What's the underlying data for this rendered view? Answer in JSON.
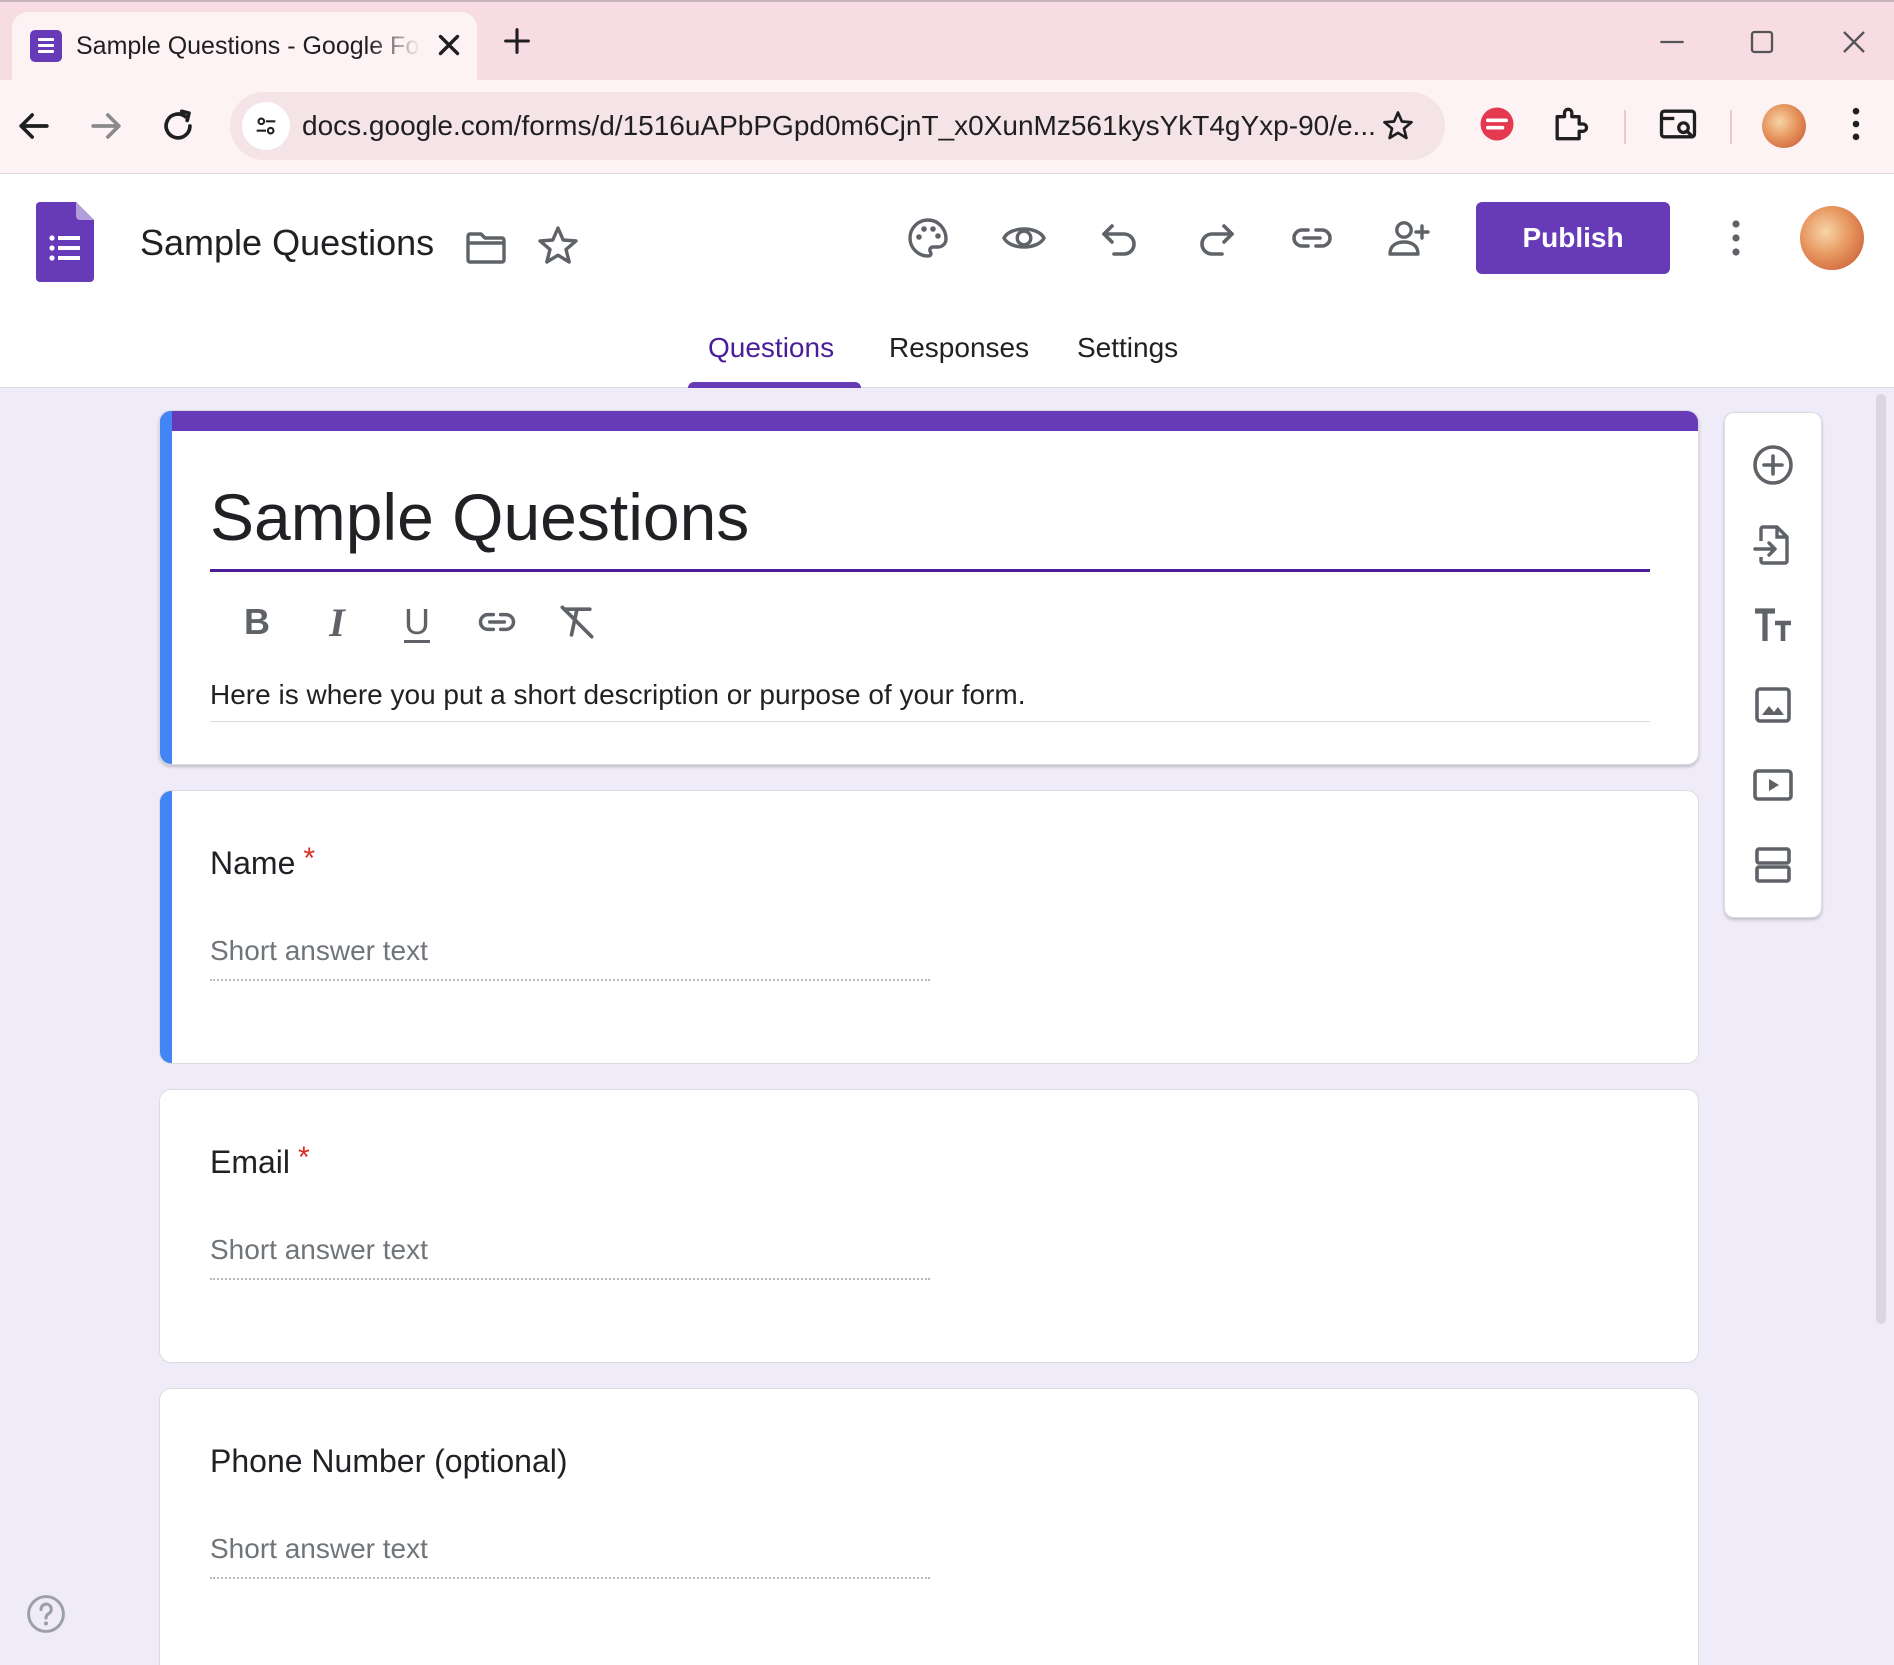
{
  "browser": {
    "tab_title": "Sample Questions - Google Forms",
    "url": "docs.google.com/forms/d/1516uAPbPGpd0m6CjnT_x0XunMz561kysYkT4gYxp-90/e..."
  },
  "header": {
    "doc_title": "Sample Questions",
    "publish_label": "Publish",
    "tabs": [
      {
        "label": "Questions",
        "active": true
      },
      {
        "label": "Responses",
        "active": false
      },
      {
        "label": "Settings",
        "active": false
      }
    ]
  },
  "form": {
    "title": "Sample Questions",
    "description": "Here is where you put a short description or purpose of your form.",
    "questions": [
      {
        "label": "Name",
        "required": true,
        "required_mark": "*",
        "placeholder": "Short answer text"
      },
      {
        "label": "Email",
        "required": true,
        "required_mark": "*",
        "placeholder": "Short answer text"
      },
      {
        "label": "Phone Number (optional)",
        "required": false,
        "placeholder": "Short answer text"
      }
    ],
    "format_toolbar": [
      "B",
      "I",
      "U",
      "link-icon",
      "clear-format-icon"
    ]
  },
  "side_tools": [
    "add-question-icon",
    "import-questions-icon",
    "add-title-icon",
    "add-image-icon",
    "add-video-icon",
    "add-section-icon"
  ],
  "colors": {
    "accent": "#673ab7",
    "active_tab": "#4b1e99",
    "selected_card": "#4285f4",
    "canvas_bg": "#f0ebf8",
    "required": "#d93025"
  }
}
